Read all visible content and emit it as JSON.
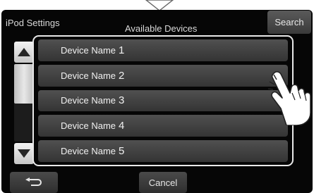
{
  "header": {
    "title": "iPod Settings",
    "subtitle": "Available Devices",
    "search_label": "Search"
  },
  "devices": [
    {
      "name": "Device Name",
      "number": "1"
    },
    {
      "name": "Device Name",
      "number": "2"
    },
    {
      "name": "Device Name",
      "number": "3"
    },
    {
      "name": "Device Name",
      "number": "4"
    },
    {
      "name": "Device Name",
      "number": "5"
    }
  ],
  "footer": {
    "back_icon": "return-arrow-icon",
    "cancel_label": "Cancel"
  },
  "colors": {
    "screen_background": "#060606",
    "row_background": "#454545",
    "panel_border": "#e8e8e8",
    "text": "#f0f0f0"
  }
}
